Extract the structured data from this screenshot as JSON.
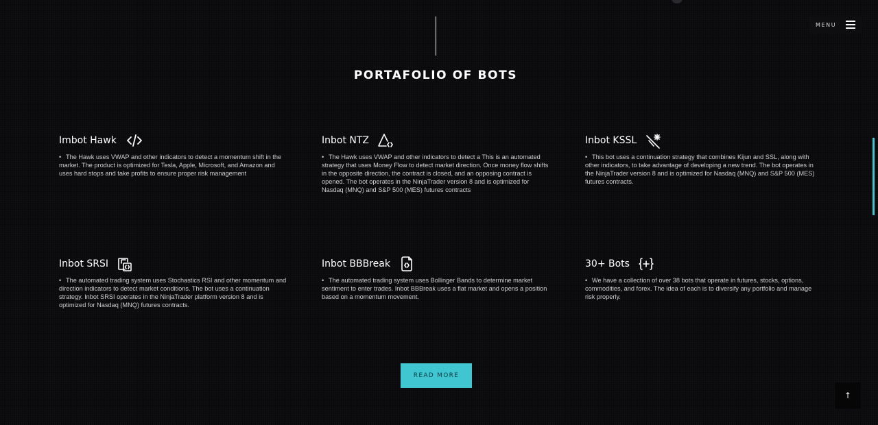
{
  "header": {
    "menu_label": "MENU",
    "section_title": "PORTAFOLIO OF BOTS"
  },
  "bots": [
    {
      "title": "Imbot Hawk",
      "icon": "code-icon",
      "bullet": "•",
      "description": "The Hawk uses VWAP and other indicators to detect a momentum shift in the market. The product is optimized for Tesla, Apple, Microsoft, and Amazon and uses hard stops and take profits to ensure proper risk management"
    },
    {
      "title": "Inbot NTZ",
      "icon": "triangle-code-icon",
      "bullet": "•",
      "description": "The Hawk uses VWAP and other indicators to detect a This is an automated strategy that uses Money Flow to detect market direction. Once money flow shifts in the opposite direction, the contract is closed, and an opposing contract is opened. The bot operates in the NinjaTrader version 8 and is optimized for Nasdaq (MNQ) and S&P 500 (MES) futures contracts"
    },
    {
      "title": "Inbot KSSL",
      "icon": "magic-wand-icon",
      "bullet": "•",
      "description": "This bot uses a continuation strategy that combines Kijun and SSL, along with other indicators, to take advantage of developing a new trend. The bot operates in the NinjaTrader version 8 and is optimized for Nasdaq (MNQ) and S&P 500 (MES) futures contracts."
    },
    {
      "title": "Inbot SRSI",
      "icon": "devices-code-icon",
      "bullet": "•",
      "description": "The automated trading system uses Stochastics RSI and other momentum and direction indicators to detect market conditions. The bot uses a continuation strategy. Inbot SRSI operates in the NinjaTrader platform version 8 and is optimized for Nasdaq (MNQ) futures contracts."
    },
    {
      "title": "Inbot BBBreak",
      "icon": "file-code-icon",
      "bullet": "•",
      "description": "The automated trading system uses Bollinger Bands to determine market sentiment to enter trades. Inbot BBBreak uses a flat market and opens a position based on a momentum movement."
    },
    {
      "title": "30+ Bots",
      "icon": "braces-plus-icon",
      "bullet": "•",
      "description": "We have a collection of over 38 bots that operate in futures, stocks, options, commodities, and forex. The idea of each is to diversify any portfolio and manage risk properly."
    }
  ],
  "actions": {
    "read_more_label": "READ MORE",
    "back_to_top_label": "↑"
  },
  "colors": {
    "accent": "#3fc6d0",
    "background": "#0b0b0d",
    "text": "#ffffff"
  }
}
